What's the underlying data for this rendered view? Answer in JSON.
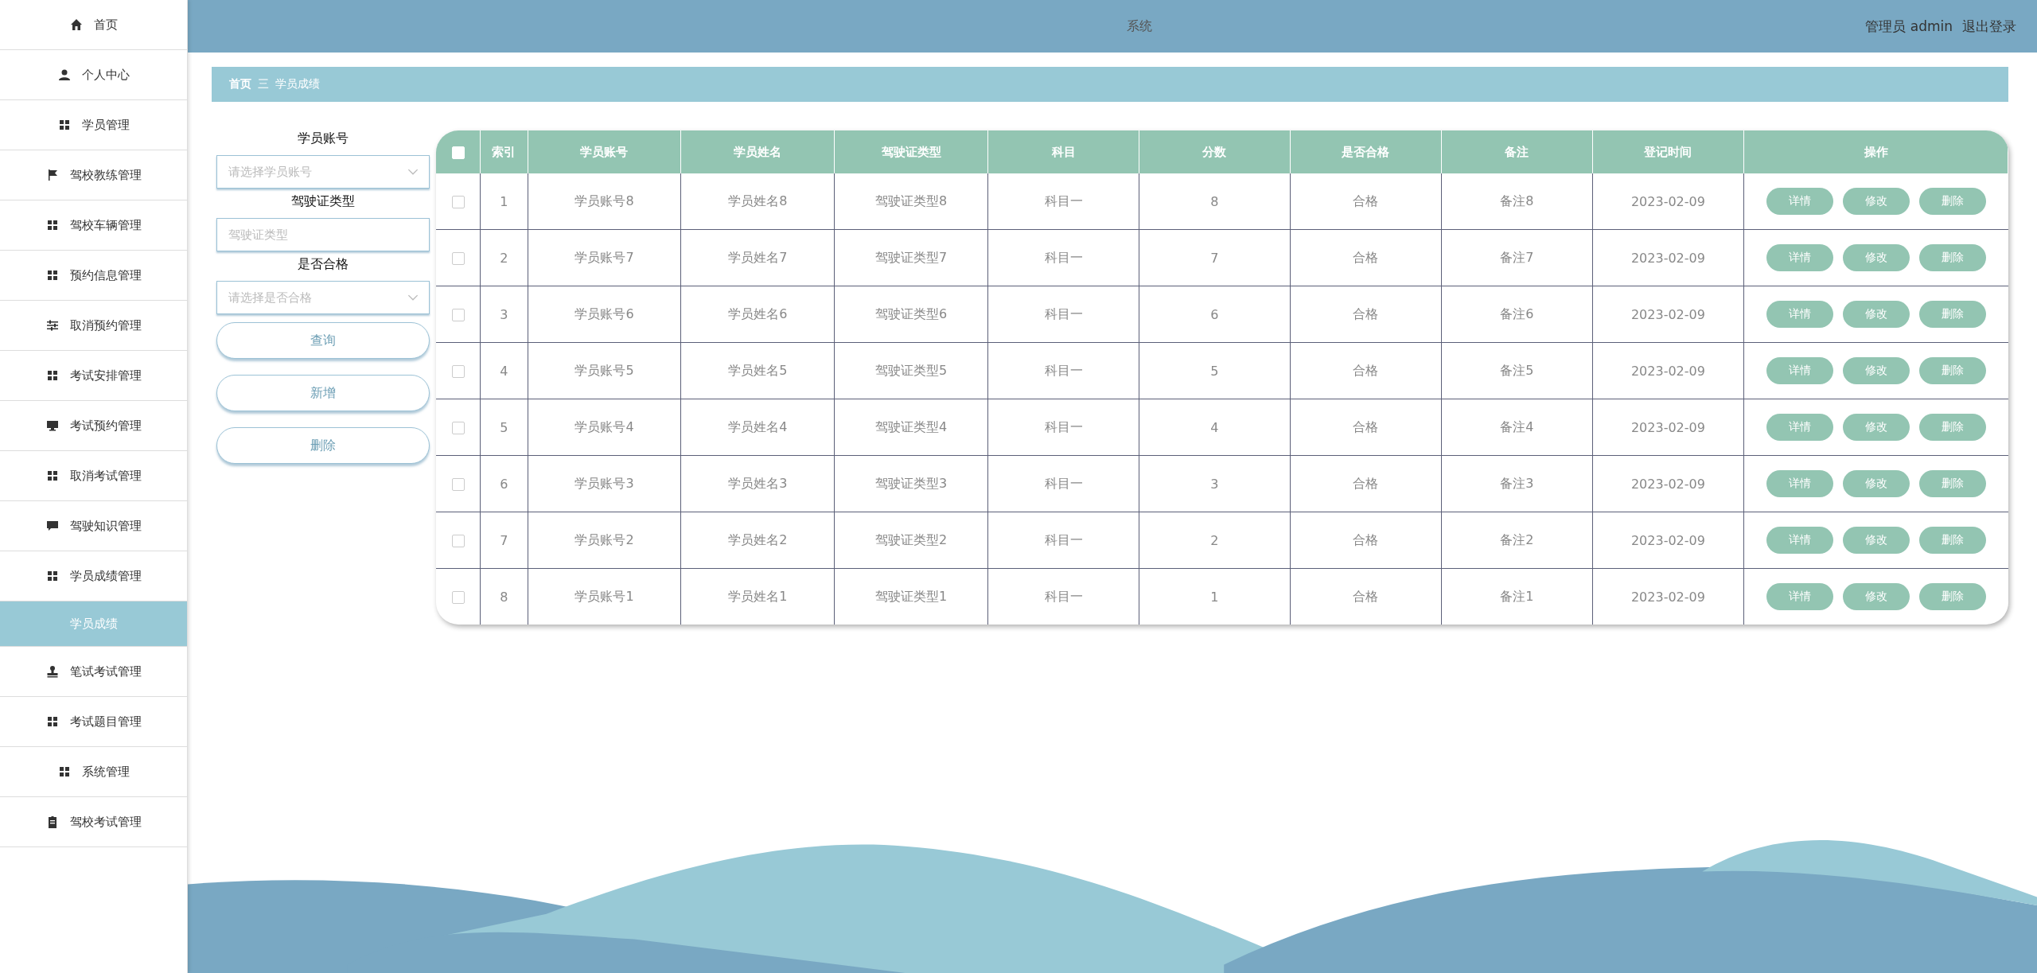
{
  "header": {
    "title": "系统",
    "user_label": "管理员 admin",
    "logout": "退出登录"
  },
  "sidebar": {
    "items": [
      {
        "label": "首页",
        "kind": "home",
        "selected": false
      },
      {
        "label": "个人中心",
        "kind": "user",
        "selected": false
      },
      {
        "label": "学员管理",
        "kind": "grid",
        "selected": false
      },
      {
        "label": "驾校教练管理",
        "kind": "flag",
        "selected": false
      },
      {
        "label": "驾校车辆管理",
        "kind": "grid",
        "selected": false
      },
      {
        "label": "预约信息管理",
        "kind": "grid",
        "selected": false
      },
      {
        "label": "取消预约管理",
        "kind": "sliders",
        "selected": false
      },
      {
        "label": "考试安排管理",
        "kind": "grid",
        "selected": false
      },
      {
        "label": "考试预约管理",
        "kind": "monitor",
        "selected": false
      },
      {
        "label": "取消考试管理",
        "kind": "grid",
        "selected": false
      },
      {
        "label": "驾驶知识管理",
        "kind": "chat",
        "selected": false
      },
      {
        "label": "学员成绩管理",
        "kind": "grid",
        "selected": false,
        "children": [
          {
            "label": "学员成绩",
            "selected": true
          }
        ]
      },
      {
        "label": "笔试考试管理",
        "kind": "stamp",
        "selected": false
      },
      {
        "label": "考试题目管理",
        "kind": "grid",
        "selected": false
      },
      {
        "label": "系统管理",
        "kind": "grid",
        "selected": false
      },
      {
        "label": "驾校考试管理",
        "kind": "clipboard",
        "selected": false
      }
    ]
  },
  "breadcrumb": {
    "home": "首页",
    "separator": "三",
    "current": "学员成绩"
  },
  "filters": [
    {
      "label": "学员账号",
      "kind": "select",
      "placeholder": "请选择学员账号"
    },
    {
      "label": "驾驶证类型",
      "kind": "input",
      "placeholder": "驾驶证类型"
    },
    {
      "label": "是否合格",
      "kind": "select",
      "placeholder": "请选择是否合格"
    }
  ],
  "filter_buttons": [
    "查询",
    "新增",
    "删除"
  ],
  "table": {
    "header_checked": false,
    "columns": [
      "索引",
      "学员账号",
      "学员姓名",
      "驾驶证类型",
      "科目",
      "分数",
      "是否合格",
      "备注",
      "登记时间",
      "操作"
    ],
    "rows": [
      {
        "checked": false,
        "cells": [
          "1",
          "学员账号8",
          "学员姓名8",
          "驾驶证类型8",
          "科目一",
          "8",
          "合格",
          "备注8",
          "2023-02-09"
        ],
        "actions": [
          "详情",
          "修改",
          "删除"
        ]
      },
      {
        "checked": false,
        "cells": [
          "2",
          "学员账号7",
          "学员姓名7",
          "驾驶证类型7",
          "科目一",
          "7",
          "合格",
          "备注7",
          "2023-02-09"
        ],
        "actions": [
          "详情",
          "修改",
          "删除"
        ]
      },
      {
        "checked": false,
        "cells": [
          "3",
          "学员账号6",
          "学员姓名6",
          "驾驶证类型6",
          "科目一",
          "6",
          "合格",
          "备注6",
          "2023-02-09"
        ],
        "actions": [
          "详情",
          "修改",
          "删除"
        ]
      },
      {
        "checked": false,
        "cells": [
          "4",
          "学员账号5",
          "学员姓名5",
          "驾驶证类型5",
          "科目一",
          "5",
          "合格",
          "备注5",
          "2023-02-09"
        ],
        "actions": [
          "详情",
          "修改",
          "删除"
        ]
      },
      {
        "checked": false,
        "cells": [
          "5",
          "学员账号4",
          "学员姓名4",
          "驾驶证类型4",
          "科目一",
          "4",
          "合格",
          "备注4",
          "2023-02-09"
        ],
        "actions": [
          "详情",
          "修改",
          "删除"
        ]
      },
      {
        "checked": false,
        "cells": [
          "6",
          "学员账号3",
          "学员姓名3",
          "驾驶证类型3",
          "科目一",
          "3",
          "合格",
          "备注3",
          "2023-02-09"
        ],
        "actions": [
          "详情",
          "修改",
          "删除"
        ]
      },
      {
        "checked": false,
        "cells": [
          "7",
          "学员账号2",
          "学员姓名2",
          "驾驶证类型2",
          "科目一",
          "2",
          "合格",
          "备注2",
          "2023-02-09"
        ],
        "actions": [
          "详情",
          "修改",
          "删除"
        ]
      },
      {
        "checked": false,
        "cells": [
          "8",
          "学员账号1",
          "学员姓名1",
          "驾驶证类型1",
          "科目一",
          "1",
          "合格",
          "备注1",
          "2023-02-09"
        ],
        "actions": [
          "详情",
          "修改",
          "删除"
        ]
      }
    ]
  }
}
